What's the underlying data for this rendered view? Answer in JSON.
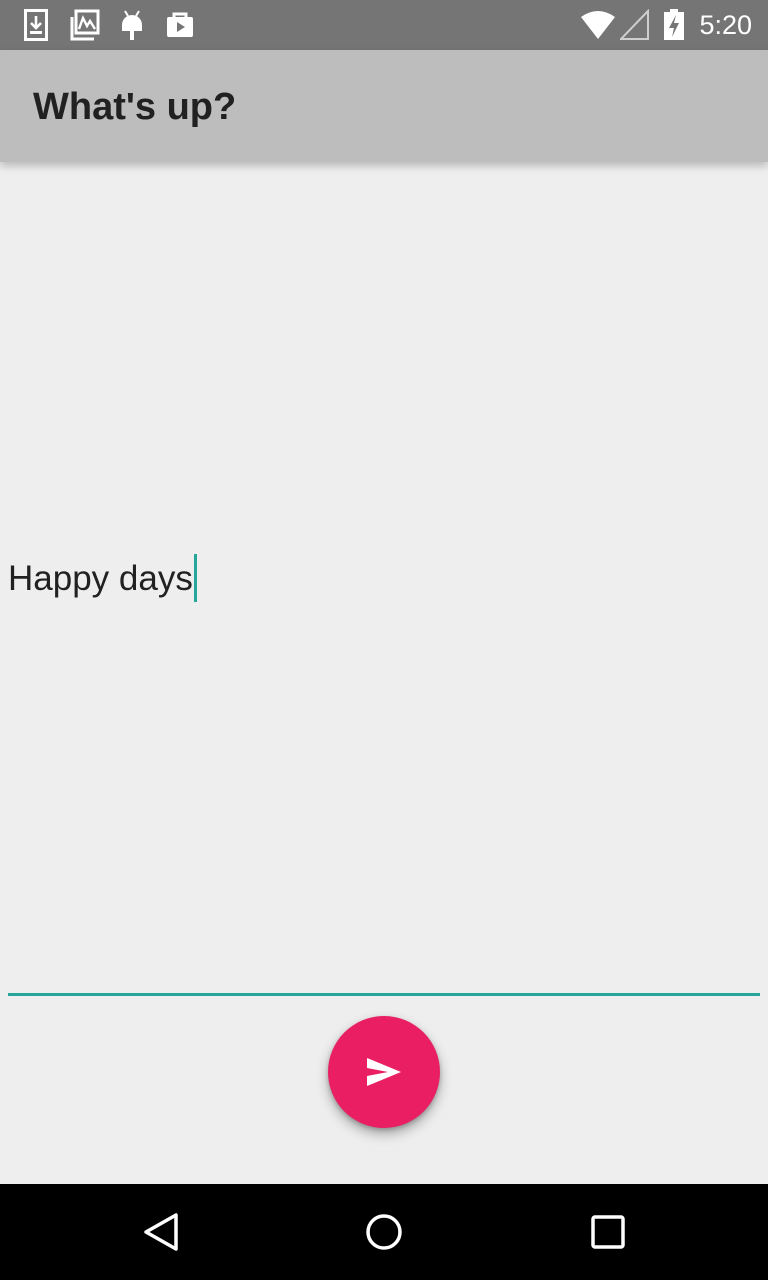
{
  "status_bar": {
    "time": "5:20",
    "icons_left": [
      "download-icon",
      "gallery-icon",
      "android-icon",
      "store-icon"
    ],
    "icons_right": [
      "wifi-icon",
      "cell-signal-icon",
      "battery-charging-icon"
    ]
  },
  "app_bar": {
    "title": "What's up?"
  },
  "message_field": {
    "value": "Happy days",
    "accent_color": "#26a69a"
  },
  "send_button": {
    "icon": "send-icon",
    "color": "#e91e63"
  },
  "nav_bar": {
    "buttons": [
      "back-icon",
      "home-icon",
      "recents-icon"
    ]
  }
}
